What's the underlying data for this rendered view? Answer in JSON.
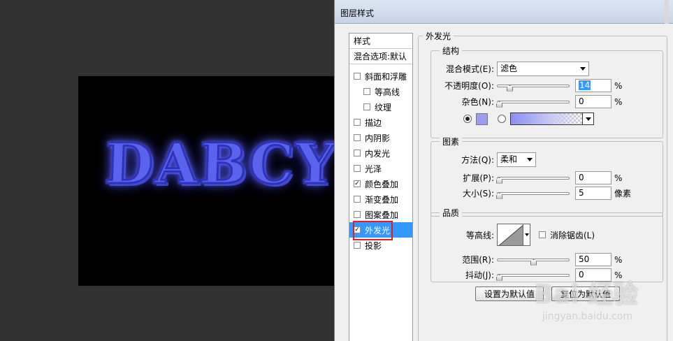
{
  "canvas": {
    "art_text": "DABCY"
  },
  "dialog": {
    "title": "图层样式",
    "list": {
      "header": "样式",
      "blend": "混合选项:默认",
      "items": [
        {
          "label": "斜面和浮雕",
          "checked": false,
          "sub": false
        },
        {
          "label": "等高线",
          "checked": false,
          "sub": true
        },
        {
          "label": "纹理",
          "checked": false,
          "sub": true
        },
        {
          "label": "描边",
          "checked": false,
          "sub": false
        },
        {
          "label": "内阴影",
          "checked": false,
          "sub": false
        },
        {
          "label": "内发光",
          "checked": false,
          "sub": false
        },
        {
          "label": "光泽",
          "checked": false,
          "sub": false
        },
        {
          "label": "颜色叠加",
          "checked": true,
          "sub": false
        },
        {
          "label": "渐变叠加",
          "checked": false,
          "sub": false
        },
        {
          "label": "图案叠加",
          "checked": false,
          "sub": false
        },
        {
          "label": "外发光",
          "checked": true,
          "sub": false,
          "selected": true
        },
        {
          "label": "投影",
          "checked": false,
          "sub": false
        }
      ]
    },
    "panel_title": "外发光",
    "structure": {
      "title": "结构",
      "blend_mode_label": "混合模式(E):",
      "blend_mode_value": "滤色",
      "opacity_label": "不透明度(O):",
      "opacity_value": "14",
      "opacity_unit": "%",
      "noise_label": "杂色(N):",
      "noise_value": "0",
      "noise_unit": "%",
      "glow_color": "#9b9cef"
    },
    "elements": {
      "title": "图素",
      "method_label": "方法(Q):",
      "method_value": "柔和",
      "spread_label": "扩展(P):",
      "spread_value": "0",
      "spread_unit": "%",
      "size_label": "大小(S):",
      "size_value": "5",
      "size_unit": "像素"
    },
    "quality": {
      "title": "品质",
      "contour_label": "等高线:",
      "antialias_label": "消除锯齿(L)",
      "range_label": "范围(R):",
      "range_value": "50",
      "range_unit": "%",
      "jitter_label": "抖动(J):",
      "jitter_value": "0",
      "jitter_unit": "%"
    },
    "buttons": {
      "make_default": "设置为默认值",
      "reset_default": "复位为默认值"
    }
  },
  "watermark": {
    "logo": "Bai 经验",
    "url": "jingyan.baidu.com"
  }
}
